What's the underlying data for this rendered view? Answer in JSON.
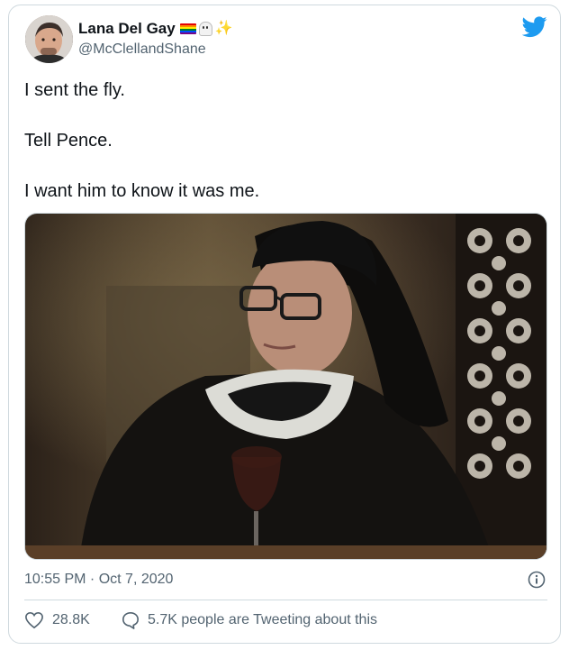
{
  "user": {
    "display_name": "Lana Del Gay",
    "handle": "@McClellandShane",
    "name_emojis": [
      "rainbow-flag",
      "ghost",
      "sparkles"
    ]
  },
  "tweet": {
    "lines": [
      "I sent the fly.",
      "Tell Pence.",
      "I want him to know it was me."
    ]
  },
  "meta": {
    "timestamp": "10:55 PM · Oct 7, 2020"
  },
  "actions": {
    "likes": "28.8K",
    "retweets_text": "5.7K people are Tweeting about this"
  },
  "colors": {
    "twitter_blue": "#1d9bf0",
    "secondary_text": "#536471",
    "border": "#cfd9de"
  }
}
